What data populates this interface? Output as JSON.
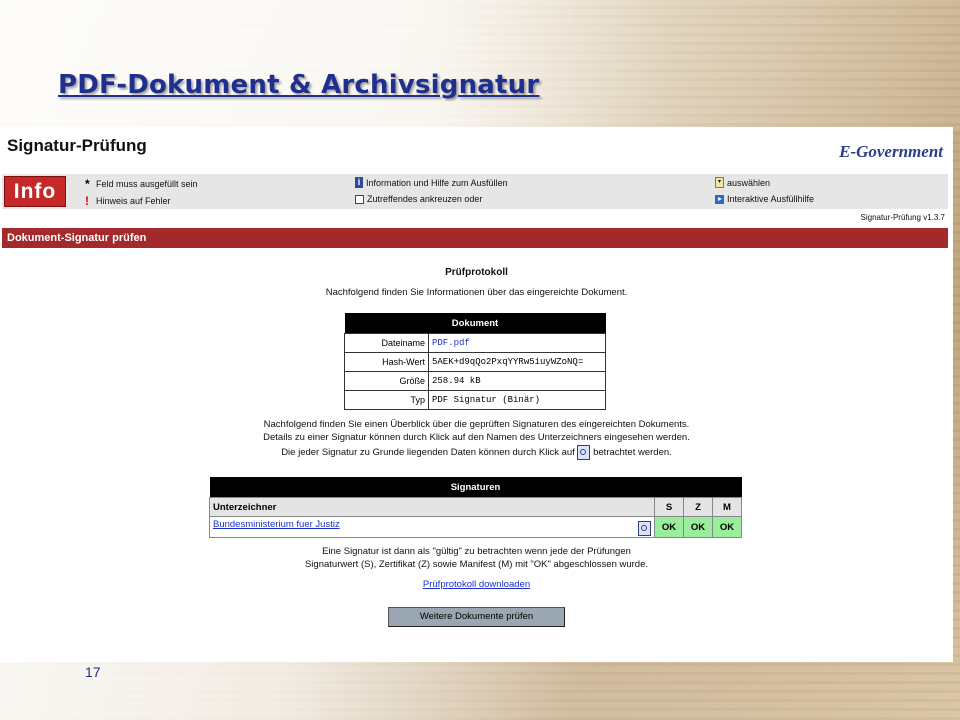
{
  "slide": {
    "title": "PDF-Dokument & Archivsignatur",
    "page_number": "17"
  },
  "header": {
    "heading": "Signatur-Prüfung",
    "brand": "E-Government"
  },
  "info_bar": {
    "logo": "Info",
    "legend": [
      {
        "icon": "asterisk-icon",
        "text": "Feld muss ausgefüllt sein"
      },
      {
        "icon": "exclamation-icon",
        "text": "Hinweis auf Fehler"
      },
      {
        "icon": "info-icon",
        "text": "Information und Hilfe zum Ausfüllen"
      },
      {
        "icon": "checkbox-icon",
        "text": "Zutreffendes ankreuzen oder"
      },
      {
        "icon": "select-icon",
        "text": "auswählen"
      },
      {
        "icon": "play-icon",
        "text": "Interaktive Ausfüllhilfe"
      }
    ]
  },
  "version": "Signatur-Prüfung v1.3.7",
  "section_bar": "Dokument-Signatur prüfen",
  "protocol": {
    "title": "Prüfprotokoll",
    "intro": "Nachfolgend finden Sie Informationen über das eingereichte Dokument."
  },
  "document_table": {
    "header": "Dokument",
    "rows": [
      {
        "key": "Dateiname",
        "value": "PDF.pdf"
      },
      {
        "key": "Hash-Wert",
        "value": "5AEK+d9qQo2PxqYYRw5iuyWZoNQ="
      },
      {
        "key": "Größe",
        "value": "258.94 kB"
      },
      {
        "key": "Typ",
        "value": "PDF Signatur (Binär)"
      }
    ]
  },
  "overview": {
    "line1": "Nachfolgend finden Sie einen Überblick über die geprüften Signaturen des eingereichten Dokuments.",
    "line2": "Details zu einer Signatur können durch Klick auf den Namen des Unterzeichners eingesehen werden.",
    "line3_before": "Die jeder Signatur zu Grunde liegenden Daten können durch Klick auf",
    "line3_after": "betrachtet werden."
  },
  "signatures_table": {
    "header": "Signaturen",
    "columns": [
      "Unterzeichner",
      "S",
      "Z",
      "M"
    ],
    "rows": [
      {
        "signer": "Bundesministerium fuer Justiz",
        "s": "OK",
        "z": "OK",
        "m": "OK"
      }
    ],
    "colors": {
      "ok": "#9bee9b"
    }
  },
  "validity_note": {
    "line1": "Eine Signatur ist dann als \"gültig\" zu betrachten wenn jede der Prüfungen",
    "line2": "Signaturwert (S), Zertifikat (Z) sowie Manifest (M) mit \"OK\" abgeschlossen wurde."
  },
  "download_link": "Prüfprotokoll downloaden",
  "button_label": "Weitere Dokumente prüfen",
  "colors": {
    "title": "#1f2f8f",
    "section_bar": "#a3292a",
    "info_logo": "#c62828"
  }
}
